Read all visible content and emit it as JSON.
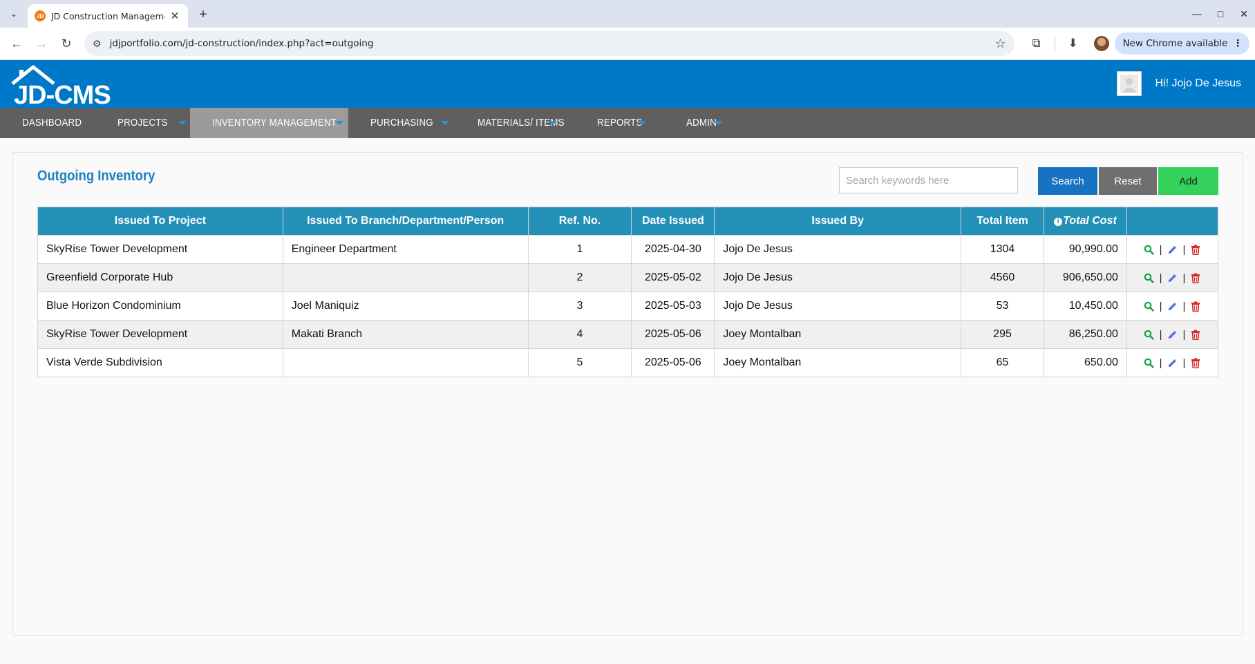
{
  "browser": {
    "tab_title": "JD Construction Manageme",
    "url": "jdjportfolio.com/jd-construction/index.php?act=outgoing",
    "update_chip": "New Chrome available"
  },
  "header": {
    "logo_text": "JD-CMS",
    "greeting": "Hi! Jojo De Jesus"
  },
  "nav": {
    "items": [
      {
        "label": "DASHBOARD"
      },
      {
        "label": "PROJECTS"
      },
      {
        "label": "INVENTORY MANAGEMENT"
      },
      {
        "label": "PURCHASING"
      },
      {
        "label": "MATERIALS/ ITEMS"
      },
      {
        "label": "REPORTS"
      },
      {
        "label": "ADMIN"
      }
    ],
    "active": "INVENTORY MANAGEMENT"
  },
  "page": {
    "title": "Outgoing Inventory",
    "search_placeholder": "Search keywords here",
    "search_label": "Search",
    "reset_label": "Reset",
    "add_label": "Add"
  },
  "table": {
    "columns": [
      "Issued To Project",
      "Issued To Branch/Department/Person",
      "Ref. No.",
      "Date Issued",
      "Issued By",
      "Total Item",
      "Total Cost",
      ""
    ],
    "rows": [
      {
        "project": "SkyRise Tower Development",
        "issued_to": "Engineer Department",
        "ref": "1",
        "date": "2025-04-30",
        "issued_by": "Jojo De Jesus",
        "total_item": "1304",
        "total_cost": "90,990.00"
      },
      {
        "project": "Greenfield Corporate Hub",
        "issued_to": "",
        "ref": "2",
        "date": "2025-05-02",
        "issued_by": "Jojo De Jesus",
        "total_item": "4560",
        "total_cost": "906,650.00"
      },
      {
        "project": "Blue Horizon Condominium",
        "issued_to": "Joel Maniquiz",
        "ref": "3",
        "date": "2025-05-03",
        "issued_by": "Jojo De Jesus",
        "total_item": "53",
        "total_cost": "10,450.00"
      },
      {
        "project": "SkyRise Tower Development",
        "issued_to": "Makati Branch",
        "ref": "4",
        "date": "2025-05-06",
        "issued_by": "Joey Montalban",
        "total_item": "295",
        "total_cost": "86,250.00"
      },
      {
        "project": "Vista Verde Subdivision",
        "issued_to": "",
        "ref": "5",
        "date": "2025-05-06",
        "issued_by": "Joey Montalban",
        "total_item": "65",
        "total_cost": "650.00"
      }
    ],
    "row_actions": [
      "view-icon",
      "edit-icon",
      "delete-icon"
    ],
    "action_separator": "|"
  },
  "colors": {
    "header_blue": "#0078c8",
    "nav_gray": "#5f5f5f",
    "table_header": "#2390b8",
    "search_btn": "#1673c2",
    "reset_btn": "#6f6f6f",
    "add_btn": "#34d25d"
  }
}
